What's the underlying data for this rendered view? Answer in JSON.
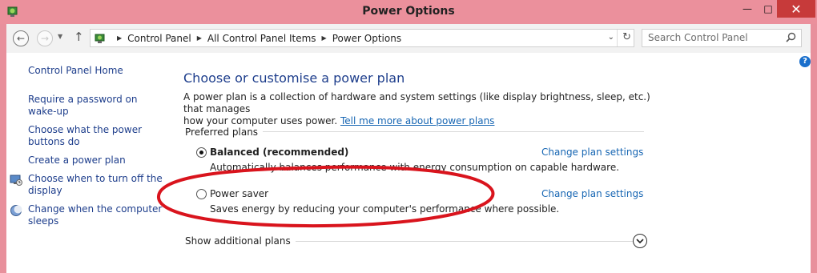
{
  "window": {
    "title": "Power Options"
  },
  "address_bar": {
    "breadcrumbs": [
      "Control Panel",
      "All Control Panel Items",
      "Power Options"
    ],
    "search_placeholder": "Search Control Panel"
  },
  "sidebar": {
    "home_link": "Control Panel Home",
    "links": [
      {
        "label_line1": "Require a password on",
        "label_line2": "wake-up",
        "icon": ""
      },
      {
        "label_line1": "Choose what the power",
        "label_line2": "buttons do",
        "icon": ""
      },
      {
        "label_line1": "Create a power plan",
        "label_line2": "",
        "icon": ""
      },
      {
        "label_line1": "Choose when to turn off the",
        "label_line2": "display",
        "icon": "monitor-icon"
      },
      {
        "label_line1": "Change when the computer",
        "label_line2": "sleeps",
        "icon": "moon-icon"
      }
    ]
  },
  "main": {
    "heading": "Choose or customise a power plan",
    "description_line1": "A power plan is a collection of hardware and system settings (like display brightness, sleep, etc.) that manages",
    "description_line2": "how your computer uses power. ",
    "description_link": "Tell me more about power plans",
    "preferred_plans_label": "Preferred plans",
    "plans": [
      {
        "name": "Balanced (recommended)",
        "description": "Automatically balances performance with energy consumption on capable hardware.",
        "selected": true,
        "link": "Change plan settings"
      },
      {
        "name": "Power saver",
        "description": "Saves energy by reducing your computer's performance where possible.",
        "selected": false,
        "link": "Change plan settings"
      }
    ],
    "additional_plans_label": "Show additional plans"
  },
  "colors": {
    "titlebar": "#eb909c",
    "link": "#1766b3",
    "sidebar_link": "#1e3e8c",
    "annotation": "#d9141d"
  }
}
